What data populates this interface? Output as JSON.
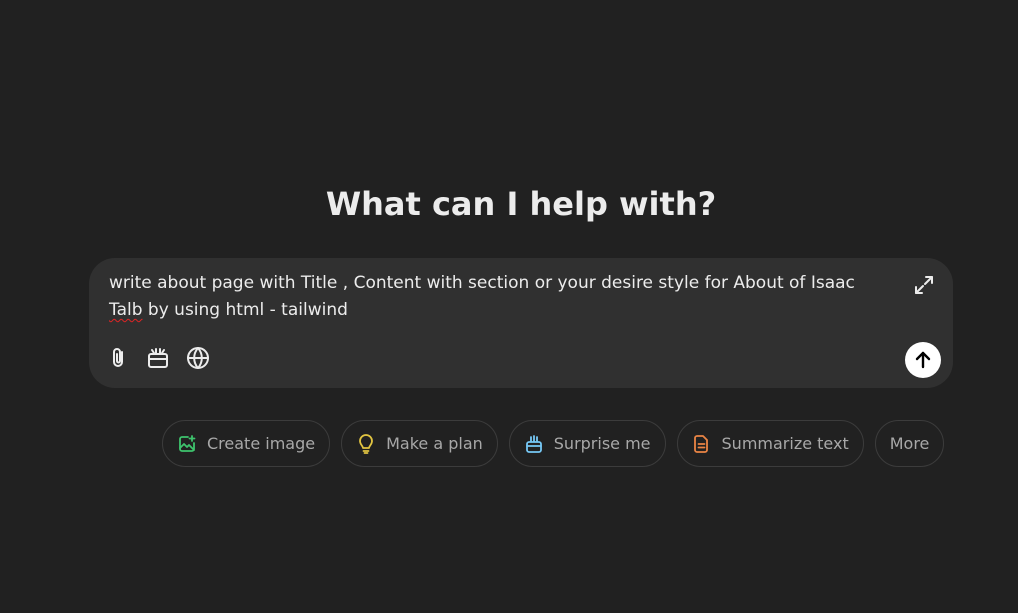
{
  "heading": "What can I help with?",
  "composer": {
    "text_before": "write about page with Title , Content with section or your desire style for About of Isaac ",
    "misspelled_word": "Talb",
    "text_after": " by using html - tailwind"
  },
  "chips": [
    {
      "label": "Create image",
      "icon": "image-icon",
      "color": "#3ec46d"
    },
    {
      "label": "Make a plan",
      "icon": "lightbulb-icon",
      "color": "#e2c541"
    },
    {
      "label": "Surprise me",
      "icon": "gift-icon",
      "color": "#76c8f5"
    },
    {
      "label": "Summarize text",
      "icon": "document-icon",
      "color": "#ea8444"
    },
    {
      "label": "More",
      "icon": null
    }
  ],
  "colors": {
    "background": "#212121",
    "composer": "#303030",
    "text": "#ececec",
    "chip_text": "#a8a8a8",
    "chip_border": "#3c3c3c",
    "send_button": "#ffffff"
  }
}
